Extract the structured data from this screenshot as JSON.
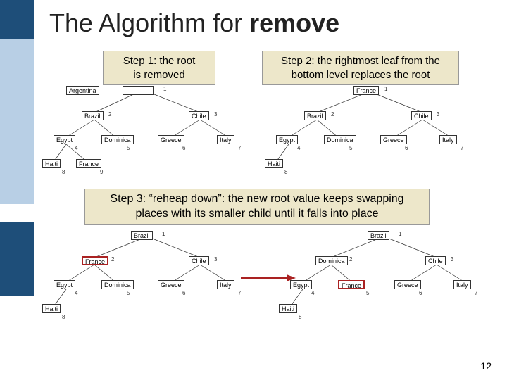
{
  "title_pre": "The Algorithm for ",
  "title_bold": "remove",
  "step1": "Step 1: the root\nis removed",
  "step2": "Step 2: the rightmost leaf from the\nbottom level replaces the root",
  "step3": "Step 3: “reheap down”: the new root value keeps swapping\nplaces with its smaller child until it falls into place",
  "page_num": "12",
  "tree1": {
    "root_struck": "Argentina",
    "n2": "Brazil",
    "n3": "Chile",
    "n4": "Egypt",
    "n5": "Dominica",
    "n6": "Greece",
    "n7": "Italy",
    "n8": "Haiti",
    "n9": "France"
  },
  "tree2": {
    "n1": "France",
    "n2": "Brazil",
    "n3": "Chile",
    "n4": "Egypt",
    "n5": "Dominica",
    "n6": "Greece",
    "n7": "Italy",
    "n8": "Haiti"
  },
  "tree3": {
    "n1": "Brazil",
    "n2": "France",
    "n3": "Chile",
    "n4": "Egypt",
    "n5": "Dominica",
    "n6": "Greece",
    "n7": "Italy",
    "n8": "Haiti"
  },
  "tree4": {
    "n1": "Brazil",
    "n2": "Dominica",
    "n3": "Chile",
    "n4": "Egypt",
    "n5": "France",
    "n6": "Greece",
    "n7": "Italy",
    "n8": "Haiti"
  },
  "idx": {
    "i1": "1",
    "i2": "2",
    "i3": "3",
    "i4": "4",
    "i5": "5",
    "i6": "6",
    "i7": "7",
    "i8": "8",
    "i9": "9"
  }
}
